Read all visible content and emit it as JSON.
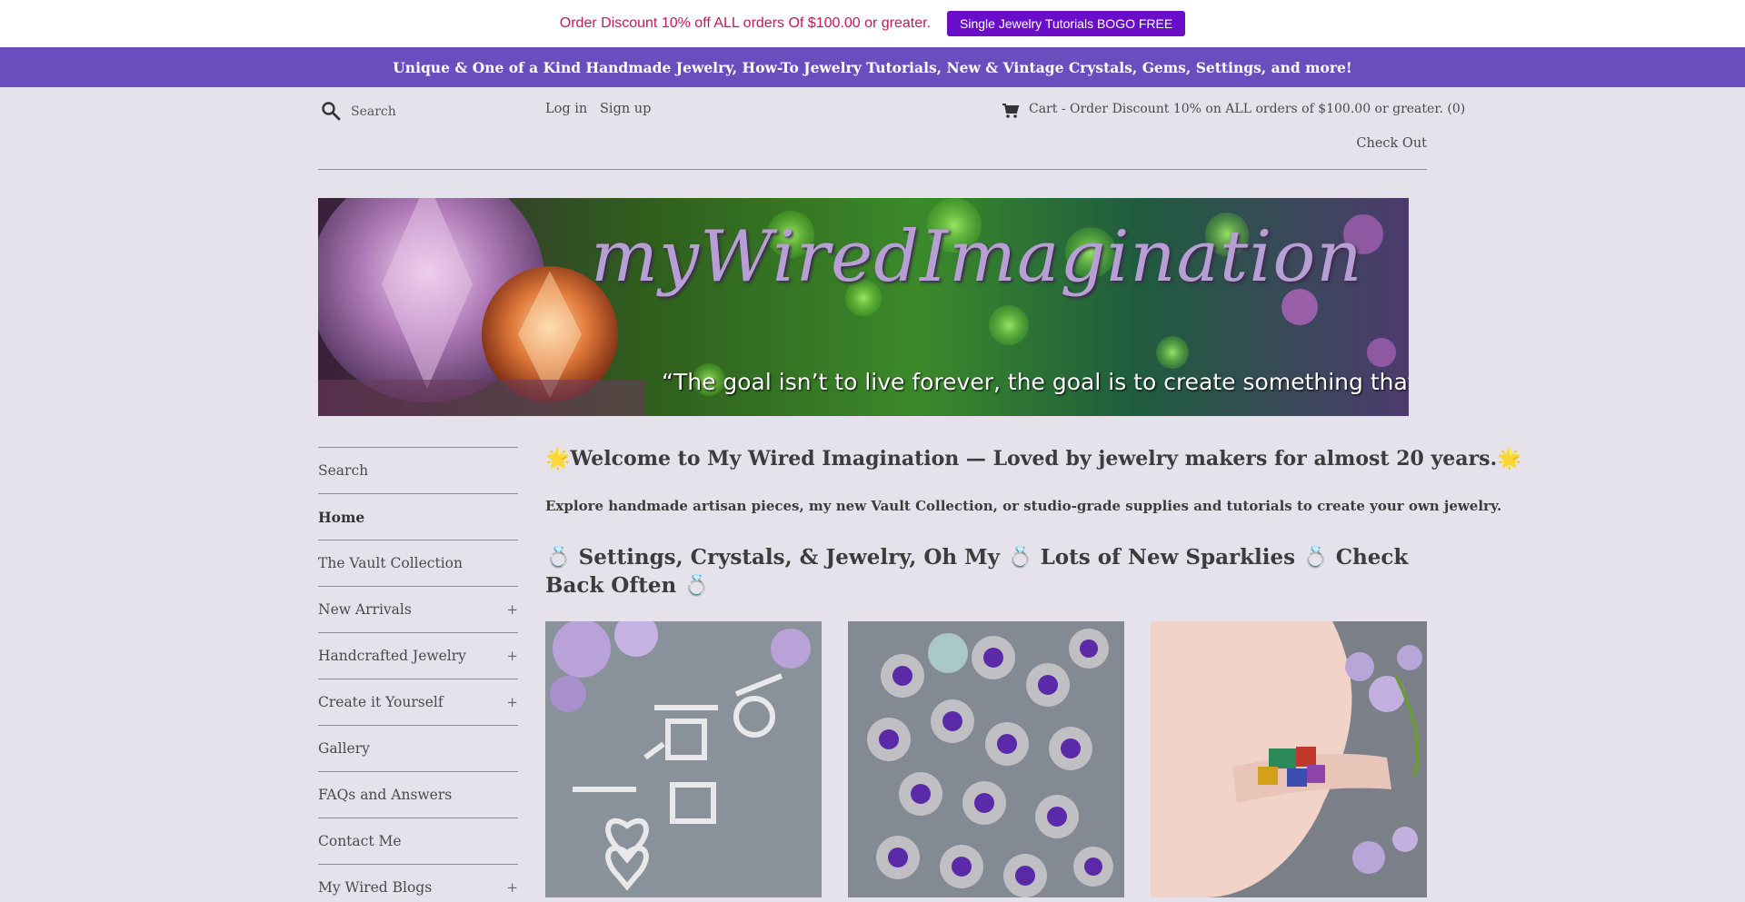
{
  "promo": {
    "text": "Order Discount 10% off ALL orders Of $100.00 or greater.",
    "button_label": "Single Jewelry Tutorials BOGO FREE"
  },
  "announcement": "Unique & One of a Kind Handmade Jewelry, How-To Jewelry Tutorials, New & Vintage Crystals, Gems, Settings, and more!",
  "header": {
    "search_placeholder": "Search",
    "login": "Log in",
    "signup": "Sign up",
    "cart": "Cart - Order Discount 10% on ALL orders of $100.00 or greater. (0)",
    "checkout": "Check Out"
  },
  "banner": {
    "title": "myWiredImagination",
    "quote": "“The goal isn’t to live forever, the goal is to create something that will”"
  },
  "sidebar": {
    "items": [
      {
        "label": "Search",
        "plus": ""
      },
      {
        "label": "Home",
        "plus": ""
      },
      {
        "label": "The Vault Collection",
        "plus": ""
      },
      {
        "label": "New Arrivals",
        "plus": "+"
      },
      {
        "label": "Handcrafted Jewelry",
        "plus": "+"
      },
      {
        "label": "Create it Yourself",
        "plus": "+"
      },
      {
        "label": "Gallery",
        "plus": ""
      },
      {
        "label": "FAQs and Answers",
        "plus": ""
      },
      {
        "label": "Contact Me",
        "plus": ""
      },
      {
        "label": "My Wired Blogs",
        "plus": "+"
      }
    ]
  },
  "main": {
    "welcome": "🌟Welcome to My Wired Imagination — Loved by jewelry makers for almost 20 years.🌟",
    "subtitle": "Explore handmade artisan pieces, my new Vault Collection, or studio-grade supplies and tutorials to create your own jewelry.",
    "settings_heading": "💍 Settings, Crystals, & Jewelry, Oh My 💍 Lots of New Sparklies 💍 Check Back Often 💍"
  },
  "colors": {
    "promo_text": "#c4185c",
    "promo_button": "#6a0dc9",
    "announcement_bg": "#6a4ebe",
    "page_bg": "#e6e2ec"
  }
}
